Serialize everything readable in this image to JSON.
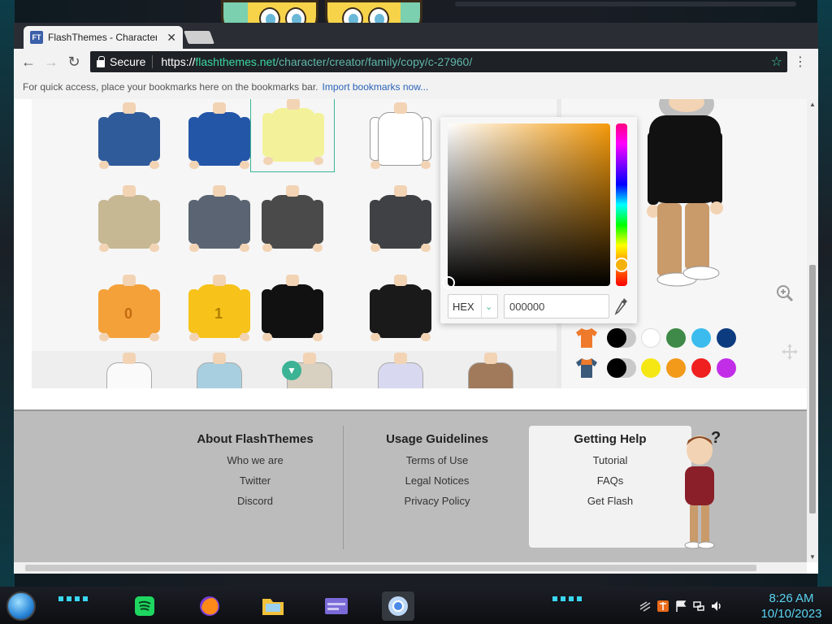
{
  "browser": {
    "tab_title": "FlashThemes - Character",
    "tab_favicon_text": "FT",
    "secure_label": "Secure",
    "url_scheme": "https://",
    "url_host": "flashthemes.net",
    "url_path": "/character/creator/family/copy/c-27960/",
    "bookmark_hint": "For quick access, place your bookmarks here on the bookmarks bar.",
    "bookmark_import": "Import bookmarks now..."
  },
  "color_picker": {
    "mode": "HEX",
    "hex_value": "000000",
    "hue_color": "#f5b20a"
  },
  "clothes": [
    {
      "name": "police-jacket",
      "color": "#2f5b9a"
    },
    {
      "name": "puffer-jacket",
      "color": "#2456a8"
    },
    {
      "name": "yellow-shirt",
      "color": "#f3f29a",
      "selected": true
    },
    {
      "name": "white-dress-shirt",
      "color": "#ffffff"
    },
    {
      "name": "military-vest",
      "color": "#c7b894"
    },
    {
      "name": "overalls",
      "color": "#5a6472"
    },
    {
      "name": "gray-suit",
      "color": "#4a4a4a"
    },
    {
      "name": "zombie-suit",
      "color": "#3f4144"
    },
    {
      "name": "orange-jersey",
      "color": "#f4a13a",
      "label": "0"
    },
    {
      "name": "yellow-jersey",
      "color": "#f7c21a",
      "label": "1"
    },
    {
      "name": "skull-tshirt",
      "color": "#111111"
    },
    {
      "name": "leather-jacket",
      "color": "#1a1a1a"
    }
  ],
  "swatches": {
    "row1": [
      "#000000",
      "#ffffff",
      "#3f8a48",
      "#3cbcee",
      "#0d3b80"
    ],
    "row2": [
      "#000000",
      "#f5e714",
      "#f39a1a",
      "#ef2020",
      "#c22ee8"
    ],
    "shirt1_color": "#ef7a2c",
    "shirt2_color": "#3b5a7a"
  },
  "footer": {
    "about": {
      "title": "About FlashThemes",
      "links": [
        "Who we are",
        "Twitter",
        "Discord"
      ]
    },
    "usage": {
      "title": "Usage Guidelines",
      "links": [
        "Terms of Use",
        "Legal Notices",
        "Privacy Policy"
      ]
    },
    "help": {
      "title": "Getting Help",
      "links": [
        "Tutorial",
        "FAQs",
        "Get Flash"
      ]
    },
    "help_mark": "?"
  },
  "clock": {
    "time": "8:26 AM",
    "date": "10/10/2023"
  }
}
